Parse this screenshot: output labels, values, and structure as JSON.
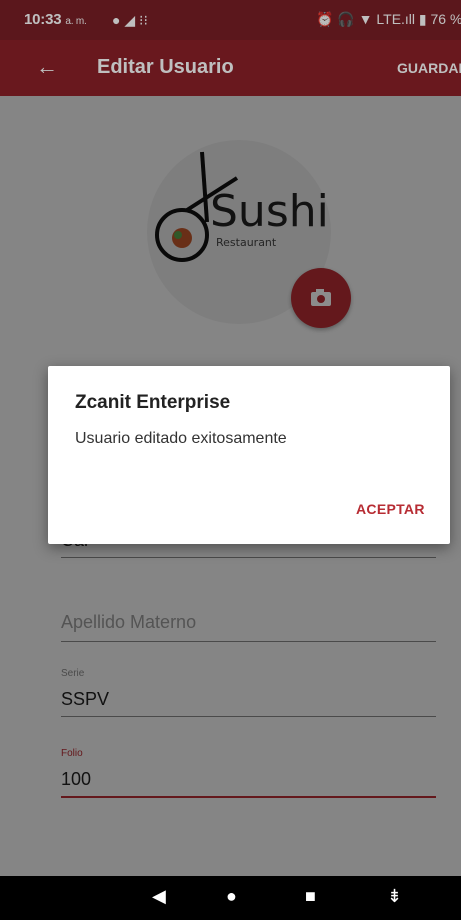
{
  "status_bar": {
    "time": "10:33",
    "ampm": "a. m.",
    "right_text": "⏰ 🎧 ▼ LTE.ıll ▮ 76 %"
  },
  "toolbar": {
    "title": "Editar Usuario",
    "save_label": "GUARDAR"
  },
  "logo": {
    "brand": "Sushi",
    "subtitle": "Restaurant"
  },
  "form": {
    "partial_value": "Cal",
    "apellido_materno_placeholder": "Apellido Materno",
    "serie_label": "Serie",
    "serie_value": "SSPV",
    "folio_label": "Folio",
    "folio_value": "100"
  },
  "dialog": {
    "title": "Zcanit Enterprise",
    "message": "Usuario editado exitosamente",
    "accept_label": "ACEPTAR"
  },
  "colors": {
    "primary": "#8c2128",
    "accent": "#b72c33"
  }
}
